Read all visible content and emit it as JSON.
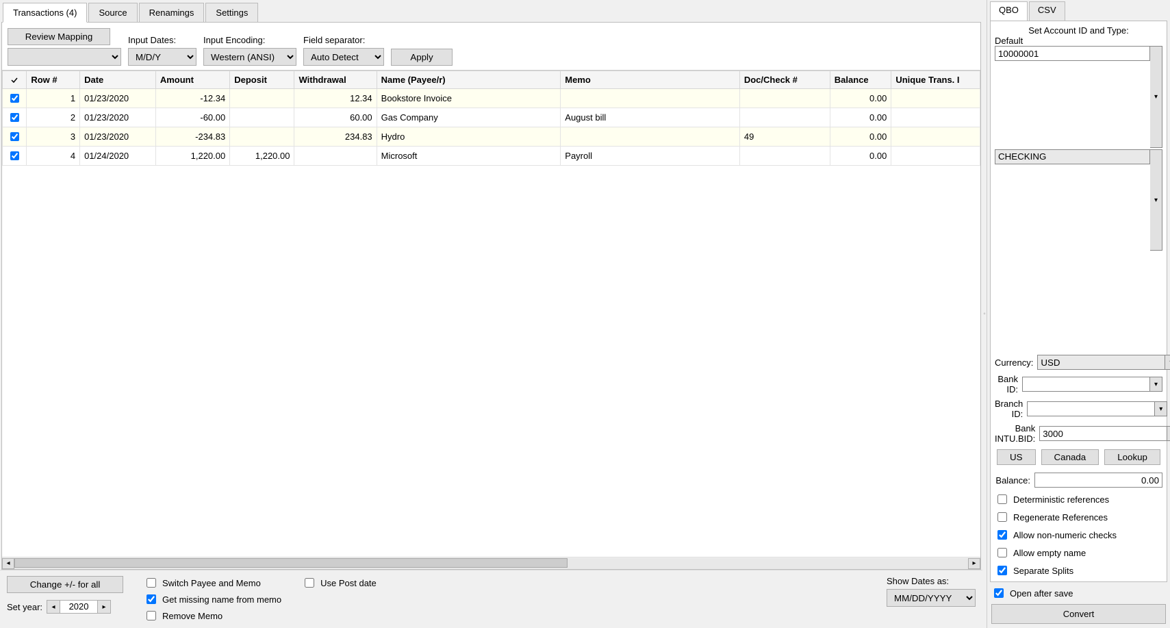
{
  "top_tabs": {
    "transactions": "Transactions (4)",
    "source": "Source",
    "renamings": "Renamings",
    "settings": "Settings"
  },
  "toolbar": {
    "review_mapping": "Review Mapping",
    "blank_select": "",
    "input_dates_label": "Input Dates:",
    "input_dates_value": "M/D/Y",
    "input_encoding_label": "Input Encoding:",
    "input_encoding_value": "Western (ANSI)",
    "field_separator_label": "Field separator:",
    "field_separator_value": "Auto Detect",
    "apply": "Apply"
  },
  "columns": {
    "row": "Row #",
    "date": "Date",
    "amount": "Amount",
    "deposit": "Deposit",
    "withdrawal": "Withdrawal",
    "name": "Name (Payee/r)",
    "memo": "Memo",
    "doc": "Doc/Check #",
    "balance": "Balance",
    "unique": "Unique Trans. I"
  },
  "rows": [
    {
      "row": "1",
      "date": "01/23/2020",
      "amount": "-12.34",
      "deposit": "",
      "withdrawal": "12.34",
      "name": "Bookstore Invoice",
      "memo": "",
      "doc": "",
      "balance": "0.00",
      "unique": ""
    },
    {
      "row": "2",
      "date": "01/23/2020",
      "amount": "-60.00",
      "deposit": "",
      "withdrawal": "60.00",
      "name": "Gas Company",
      "memo": "August bill",
      "doc": "",
      "balance": "0.00",
      "unique": ""
    },
    {
      "row": "3",
      "date": "01/23/2020",
      "amount": "-234.83",
      "deposit": "",
      "withdrawal": "234.83",
      "name": "Hydro",
      "memo": "",
      "doc": "49",
      "balance": "0.00",
      "unique": ""
    },
    {
      "row": "4",
      "date": "01/24/2020",
      "amount": "1,220.00",
      "deposit": "1,220.00",
      "withdrawal": "",
      "name": "Microsoft",
      "memo": "Payroll",
      "doc": "",
      "balance": "0.00",
      "unique": ""
    }
  ],
  "bottom": {
    "change_sign": "Change +/- for all",
    "set_year_label": "Set year:",
    "year_value": "2020",
    "switch_payee": "Switch Payee and Memo",
    "get_missing": "Get missing name from memo",
    "remove_memo": "Remove Memo",
    "use_post_date": "Use Post date",
    "show_dates_label": "Show Dates as:",
    "show_dates_value": "MM/DD/YYYY"
  },
  "right": {
    "tabs": {
      "qbo": "QBO",
      "csv": "CSV"
    },
    "set_account": "Set Account ID and Type:",
    "default": "Default",
    "account_id": "10000001",
    "account_type": "CHECKING",
    "currency_label": "Currency:",
    "currency_value": "USD",
    "bank_id_label": "Bank ID:",
    "bank_id_value": "",
    "branch_id_label": "Branch ID:",
    "branch_id_value": "",
    "bank_intu_label": "Bank INTU.BID:",
    "bank_intu_value": "3000",
    "us": "US",
    "canada": "Canada",
    "lookup": "Lookup",
    "balance_label": "Balance:",
    "balance_value": "0.00",
    "deterministic": "Deterministic references",
    "regenerate": "Regenerate References",
    "allow_nonnumeric": "Allow non-numeric checks",
    "allow_empty": "Allow empty name",
    "separate_splits": "Separate Splits",
    "open_after_save": "Open after save",
    "convert": "Convert"
  }
}
